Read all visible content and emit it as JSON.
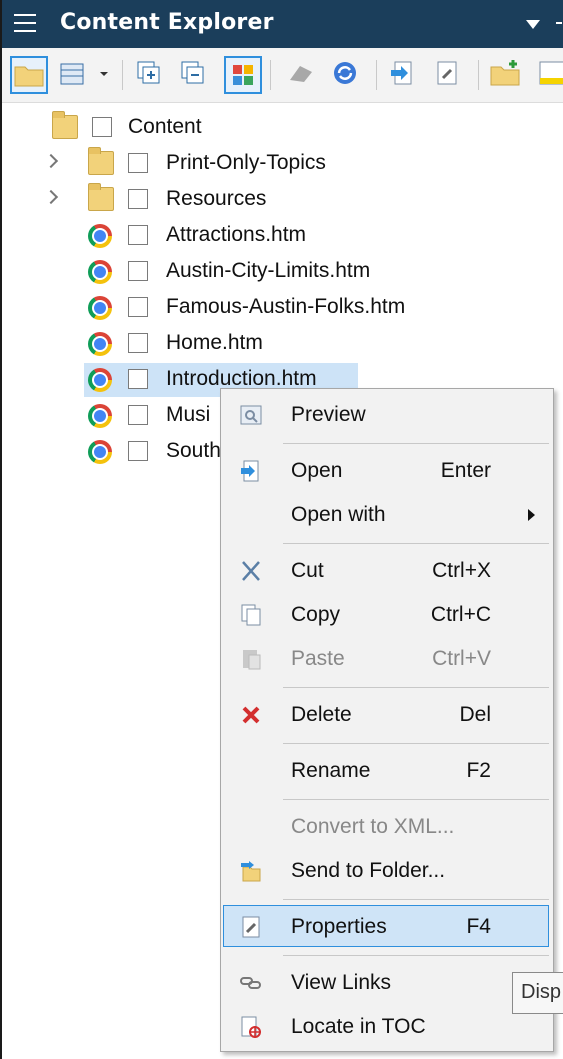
{
  "panel": {
    "title": "Content Explorer"
  },
  "toolbar": {
    "buttons": [
      {
        "icon": "folder-icon"
      },
      {
        "icon": "table-view-icon"
      },
      {
        "icon": "expand-all-icon"
      },
      {
        "icon": "collapse-all-icon"
      },
      {
        "icon": "color-grid-icon"
      },
      {
        "icon": "bind-icon"
      },
      {
        "icon": "refresh-icon"
      },
      {
        "icon": "open-file-icon"
      },
      {
        "icon": "properties-icon"
      },
      {
        "icon": "new-folder-icon"
      },
      {
        "icon": "highlight-icon"
      }
    ]
  },
  "tree": {
    "root": "Content",
    "items": [
      {
        "label": "Print-Only-Topics",
        "type": "folder"
      },
      {
        "label": "Resources",
        "type": "folder"
      },
      {
        "label": "Attractions.htm",
        "type": "file"
      },
      {
        "label": "Austin-City-Limits.htm",
        "type": "file"
      },
      {
        "label": "Famous-Austin-Folks.htm",
        "type": "file"
      },
      {
        "label": "Home.htm",
        "type": "file"
      },
      {
        "label": "Introduction.htm",
        "type": "file"
      },
      {
        "label": "Musi",
        "type": "file"
      },
      {
        "label": "South",
        "type": "file"
      }
    ]
  },
  "context_menu": {
    "items": [
      {
        "label": "Preview",
        "shortcut": ""
      },
      {
        "label": "Open",
        "shortcut": "Enter"
      },
      {
        "label": "Open with",
        "shortcut": ""
      },
      {
        "label": "Cut",
        "shortcut": "Ctrl+X"
      },
      {
        "label": "Copy",
        "shortcut": "Ctrl+C"
      },
      {
        "label": "Paste",
        "shortcut": "Ctrl+V"
      },
      {
        "label": "Delete",
        "shortcut": "Del"
      },
      {
        "label": "Rename",
        "shortcut": "F2"
      },
      {
        "label": "Convert to XML...",
        "shortcut": ""
      },
      {
        "label": "Send to Folder...",
        "shortcut": ""
      },
      {
        "label": "Properties",
        "shortcut": "F4"
      },
      {
        "label": "View Links",
        "shortcut": ""
      },
      {
        "label": "Locate in TOC",
        "shortcut": ""
      }
    ]
  },
  "tooltip": {
    "text": "Disp"
  },
  "colors": {
    "titlebar": "#1b3e5b",
    "selection": "#cde3f7",
    "accent": "#2f8fdd"
  }
}
